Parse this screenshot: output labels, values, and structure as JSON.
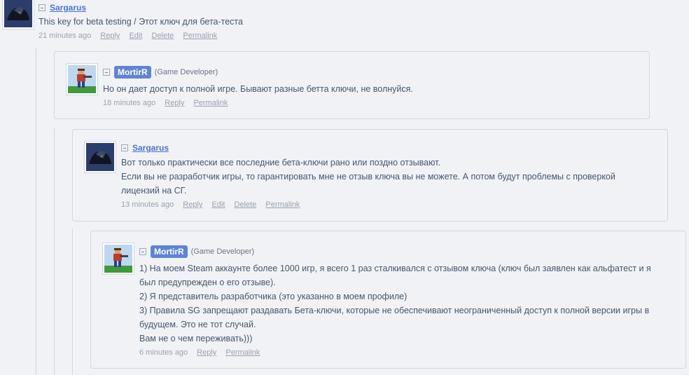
{
  "comments": [
    {
      "username": "Sargarus",
      "role": "",
      "lines": [
        "This key for beta testing / Этот ключ для бета-теста"
      ],
      "time": "21 minutes ago",
      "actions": [
        "Reply",
        "Edit",
        "Delete",
        "Permalink"
      ],
      "avatar": "dark-creature-avatar"
    },
    {
      "username": "MortirR",
      "role": "(Game Developer)",
      "lines": [
        "Но он дает доступ к полной игре. Бывают разные бетта ключи, не волнуйся."
      ],
      "time": "18 minutes ago",
      "actions": [
        "Reply",
        "Permalink"
      ],
      "avatar": "pixel-soldier-avatar"
    },
    {
      "username": "Sargarus",
      "role": "",
      "lines": [
        "Вот только практически все последние бета-ключи рано или поздно отзывают.",
        "Если вы не разработчик игры, то гарантировать мне не отзыв ключа вы не можете. А потом будут проблемы с проверкой",
        "лицензий на СГ."
      ],
      "time": "13 minutes ago",
      "actions": [
        "Reply",
        "Edit",
        "Delete",
        "Permalink"
      ],
      "avatar": "dark-creature-avatar"
    },
    {
      "username": "MortirR",
      "role": "(Game Developer)",
      "lines": [
        "1) На моем Steam аккаунте более 1000 игр, я всего 1 раз сталкивался с отзывом ключа (ключ был заявлен как альфатест и я",
        "был предупрежден о его отзыве).",
        "2) Я представитель разработчика (это указанно в моем профиле)",
        "3) Правила SG запрещают раздавать Бета-ключи, которые не обеспечивают неограниченный доступ к полной версии игры в",
        "будущем. Это не тот случай.",
        "Вам не о чем переживать)))"
      ],
      "time": "6 minutes ago",
      "actions": [
        "Reply",
        "Permalink"
      ],
      "avatar": "pixel-soldier-avatar"
    }
  ],
  "colors": {
    "background": "#f0f2f5",
    "border": "#d2d6e0",
    "username": "#4b72d2",
    "developer_badge": "#5f83d7",
    "text": "#465670",
    "meta": "#9aa1b0"
  }
}
